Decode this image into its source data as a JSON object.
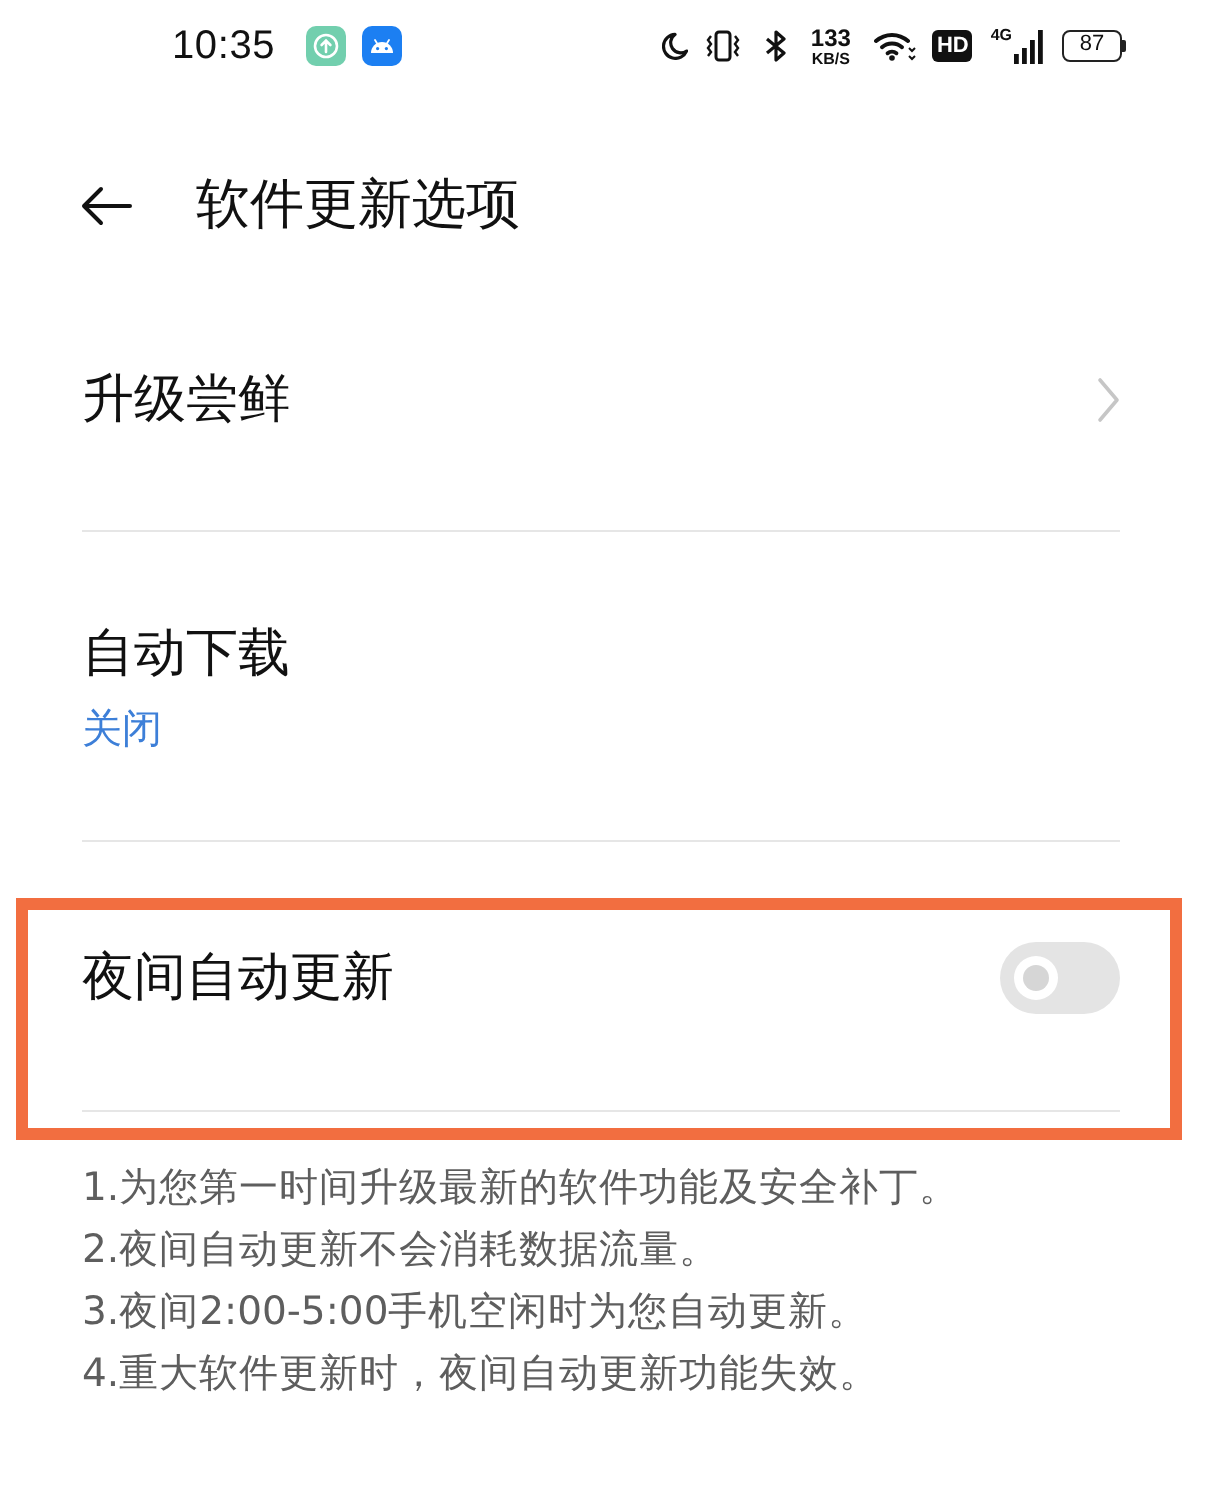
{
  "status_bar": {
    "time": "10:35",
    "speed_value": "133",
    "speed_unit": "KB/S",
    "hd_label": "HD",
    "network_type": "4G",
    "battery": "87"
  },
  "header": {
    "title": "软件更新选项"
  },
  "settings": [
    {
      "kind": "link",
      "title": "升级尝鲜",
      "highlighted": false
    },
    {
      "kind": "value",
      "title": "自动下载",
      "value": "关闭",
      "highlighted": false
    },
    {
      "kind": "switch",
      "title": "夜间自动更新",
      "on": false,
      "highlighted": true
    }
  ],
  "notes": [
    "1.为您第一时间升级最新的软件功能及安全补丁。",
    "2.夜间自动更新不会消耗数据流量。",
    "3.夜间2:00-5:00手机空闲时为您自动更新。",
    "4.重大软件更新时，夜间自动更新功能失效。"
  ]
}
